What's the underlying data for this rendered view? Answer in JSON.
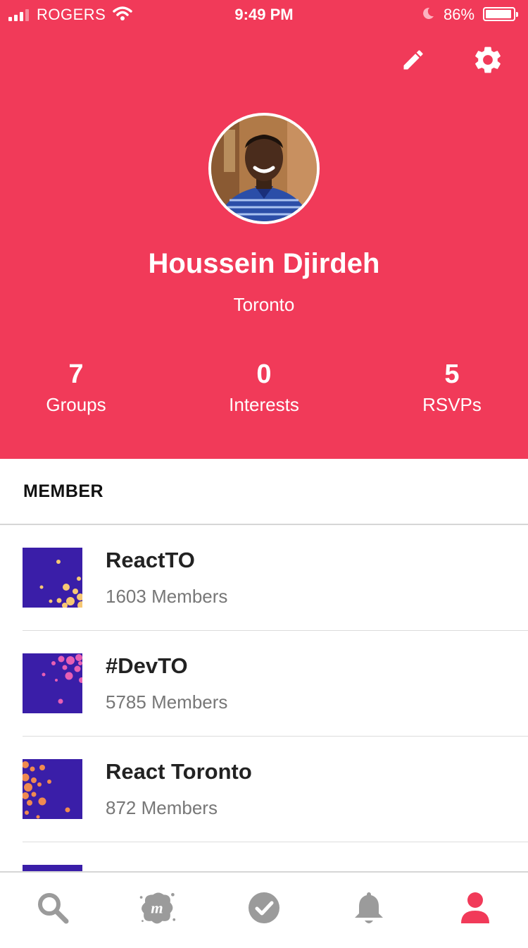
{
  "status_bar": {
    "carrier": "ROGERS",
    "time": "9:49 PM",
    "battery_percent": "86%"
  },
  "header": {
    "edit_icon": "pencil-icon",
    "settings_icon": "gear-icon"
  },
  "profile": {
    "name": "Houssein Djirdeh",
    "location": "Toronto"
  },
  "stats": [
    {
      "value": "7",
      "label": "Groups"
    },
    {
      "value": "0",
      "label": "Interests"
    },
    {
      "value": "5",
      "label": "RSVPs"
    }
  ],
  "section_title": "MEMBER",
  "groups": [
    {
      "name": "ReactTO",
      "members": "1603 Members",
      "dot_color": "#f7c873"
    },
    {
      "name": "#DevTO",
      "members": "5785 Members",
      "dot_color": "#e85fb4"
    },
    {
      "name": "React Toronto",
      "members": "872 Members",
      "dot_color": "#f08a50"
    }
  ],
  "tab_bar": {
    "tabs": [
      "search-icon",
      "meetup-logo-icon",
      "check-circle-icon",
      "bell-icon",
      "profile-icon"
    ],
    "active_color": "#f13a59",
    "inactive_color": "#9b9b9b"
  },
  "colors": {
    "brand": "#f13a59",
    "thumb_background": "#3a1ea8"
  }
}
